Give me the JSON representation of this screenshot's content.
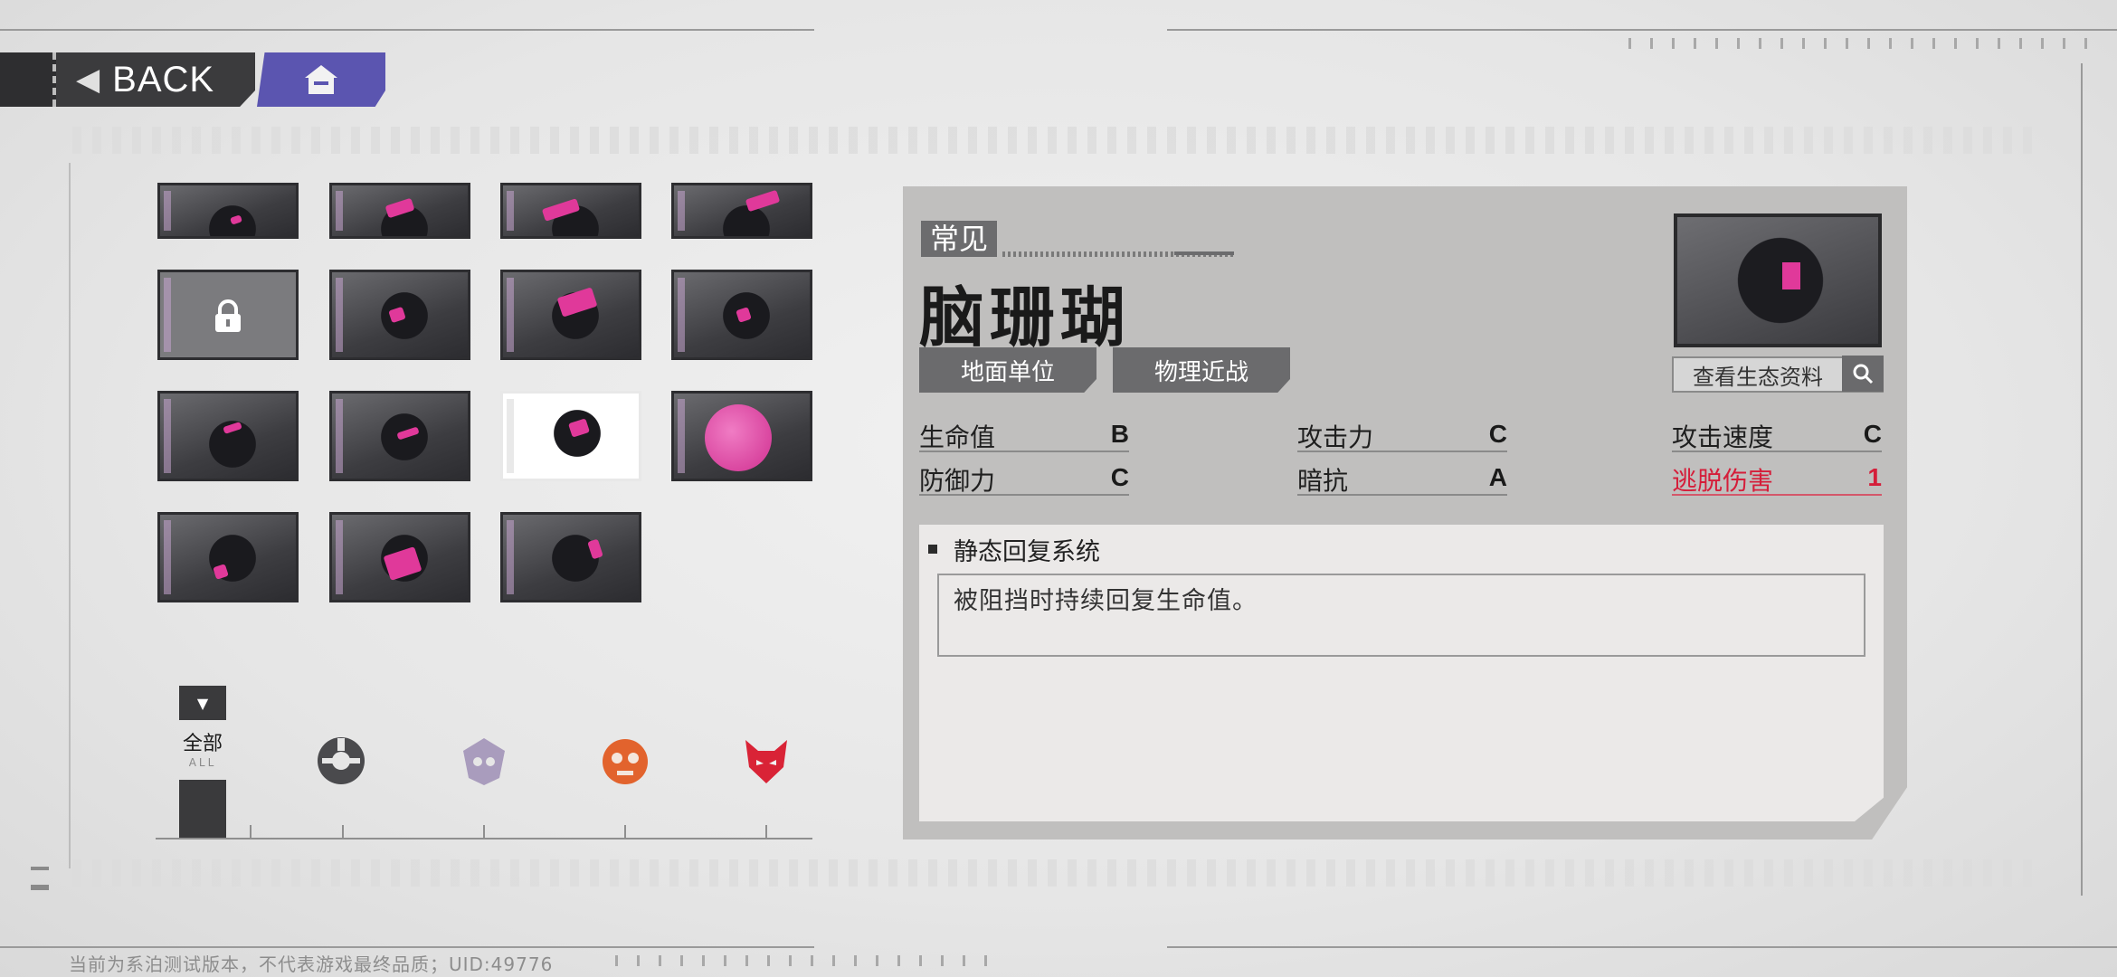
{
  "nav": {
    "back_label": "BACK",
    "home_icon": "home-icon"
  },
  "grid": {
    "top_row": [
      "enemy-1",
      "enemy-2",
      "enemy-3",
      "enemy-4"
    ],
    "cards": [
      "locked",
      "enemy-6",
      "enemy-7",
      "enemy-8",
      "enemy-9",
      "enemy-10",
      "brain-coral",
      "enemy-12",
      "enemy-13",
      "enemy-14",
      "enemy-15"
    ],
    "selected_index": 6
  },
  "filter": {
    "all_label": "全部",
    "all_sub": "ALL",
    "factions": [
      {
        "icon": "faction-dark-icon",
        "color": "#4a4a4d"
      },
      {
        "icon": "faction-purple-icon",
        "color": "#a99cbd"
      },
      {
        "icon": "faction-orange-icon",
        "color": "#e2632d"
      },
      {
        "icon": "faction-red-icon",
        "color": "#d92336"
      }
    ]
  },
  "detail": {
    "rarity": "常见",
    "name": "脑珊瑚",
    "tags": [
      "地面单位",
      "物理近战"
    ],
    "view_button": "查看生态资料",
    "stats": [
      {
        "key": "生命值",
        "value": "B"
      },
      {
        "key": "攻击力",
        "value": "C"
      },
      {
        "key": "攻击速度",
        "value": "C"
      },
      {
        "key": "防御力",
        "value": "C"
      },
      {
        "key": "暗抗",
        "value": "A"
      },
      {
        "key": "逃脱伤害",
        "value": "1"
      }
    ],
    "skill_name": "静态回复系统",
    "skill_desc": "被阻挡时持续回复生命值。"
  },
  "footer": "当前为系泊测试版本，不代表游戏最终品质；UID:49776",
  "colors": {
    "accent_pink": "#e0399a",
    "home_purple": "#5b55b0",
    "warning_red": "#d51e3a"
  }
}
